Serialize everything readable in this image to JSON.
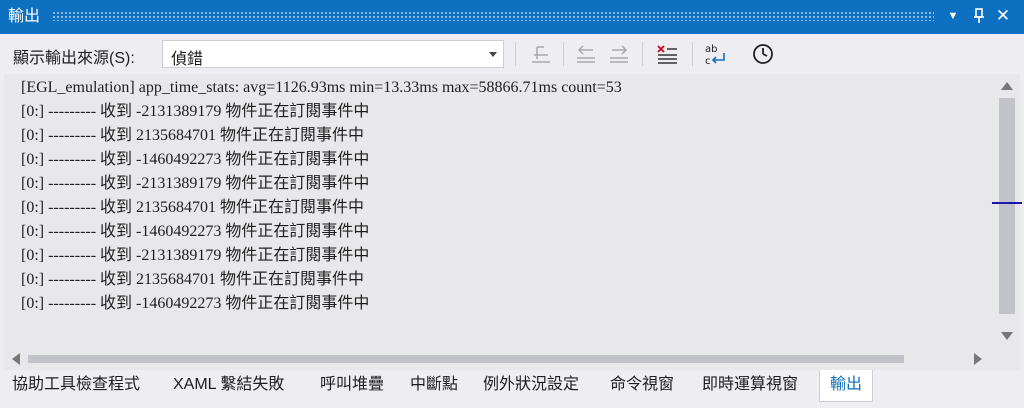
{
  "window": {
    "title": "輸出",
    "buttons": {
      "dropdown": "▼",
      "pin": "📌",
      "close": "✕"
    }
  },
  "toolbar": {
    "source_label": "顯示輸出來源(S):",
    "source_value": "偵錯",
    "icons": [
      "go-to-line-icon",
      "previous-message-icon",
      "next-message-icon",
      "clear-all-icon",
      "toggle-word-wrap-icon",
      "toggle-timestamp-icon"
    ]
  },
  "output": {
    "lines": [
      "[EGL_emulation] app_time_stats: avg=1126.93ms min=13.33ms max=58866.71ms count=53",
      "[0:] --------- 收到 -2131389179 物件正在訂閱事件中",
      "[0:] --------- 收到 2135684701 物件正在訂閱事件中",
      "[0:] --------- 收到 -1460492273 物件正在訂閱事件中",
      "[0:] --------- 收到 -2131389179 物件正在訂閱事件中",
      "[0:] --------- 收到 2135684701 物件正在訂閱事件中",
      "[0:] --------- 收到 -1460492273 物件正在訂閱事件中",
      "[0:] --------- 收到 -2131389179 物件正在訂閱事件中",
      "[0:] --------- 收到 2135684701 物件正在訂閱事件中",
      "[0:] --------- 收到 -1460492273 物件正在訂閱事件中"
    ]
  },
  "tabs": [
    {
      "label": "協助工具檢查程式",
      "active": false
    },
    {
      "label": "XAML 繫結失敗",
      "active": false
    },
    {
      "label": "呼叫堆疊",
      "active": false
    },
    {
      "label": "中斷點",
      "active": false
    },
    {
      "label": "例外狀況設定",
      "active": false
    },
    {
      "label": "命令視窗",
      "active": false
    },
    {
      "label": "即時運算視窗",
      "active": false
    },
    {
      "label": "輸出",
      "active": true
    }
  ],
  "colors": {
    "accent": "#0e70c0",
    "background": "#eeeef2",
    "output_background": "#e8e8ea",
    "scroll_marker": "#1a1aaa"
  }
}
